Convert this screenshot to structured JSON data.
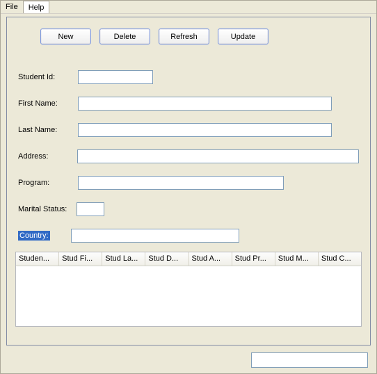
{
  "menubar": {
    "file": "File",
    "help": "Help"
  },
  "toolbar": {
    "new": "New",
    "delete": "Delete",
    "refresh": "Refresh",
    "update": "Update"
  },
  "labels": {
    "student_id": "Student Id:",
    "first_name": "First Name:",
    "last_name": "Last Name:",
    "address": "Address:",
    "program": "Program:",
    "marital_status": "Marital Status:",
    "country": "Country:"
  },
  "fields": {
    "student_id": "",
    "first_name": "",
    "last_name": "",
    "address": "",
    "program": "",
    "marital_status": "",
    "country": ""
  },
  "table": {
    "headers": {
      "c0": "Studen...",
      "c1": "Stud Fi...",
      "c2": "Stud La...",
      "c3": "Stud D...",
      "c4": "Stud A...",
      "c5": "Stud Pr...",
      "c6": "Stud M...",
      "c7": "Stud C..."
    }
  },
  "footer": {
    "value": ""
  }
}
